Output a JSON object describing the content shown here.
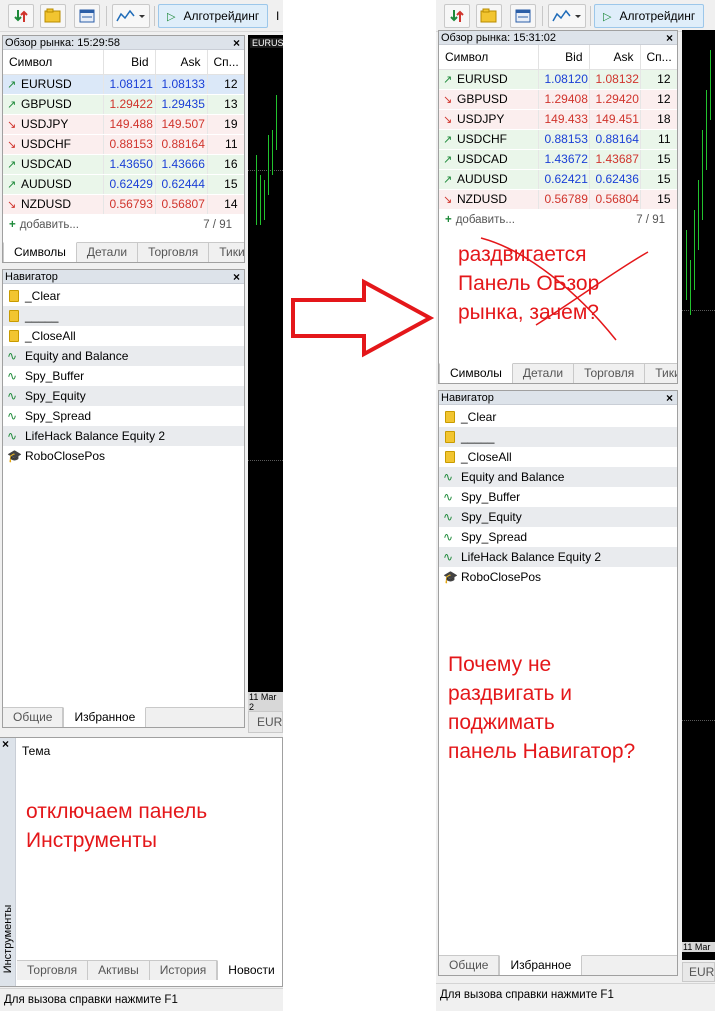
{
  "toolbar": {
    "algo_label": "Алготрейдинг",
    "extra_label_left": "I",
    "icons": [
      "trade-arrows-icon",
      "open-folder-icon",
      "template-icon",
      "chart-indicator-icon"
    ]
  },
  "left": {
    "market_watch": {
      "title": "Обзор рынка: 15:29:58",
      "columns": [
        "Символ",
        "Bid",
        "Ask",
        "Сп..."
      ],
      "rows": [
        {
          "symbol": "EURUSD",
          "bid": "1.08121",
          "ask": "1.08133",
          "spread": "12",
          "dir": "up",
          "bid_color": "blue",
          "ask_color": "blue",
          "selected": true
        },
        {
          "symbol": "GBPUSD",
          "bid": "1.29422",
          "ask": "1.29435",
          "spread": "13",
          "dir": "up",
          "bid_color": "red",
          "ask_color": "blue"
        },
        {
          "symbol": "USDJPY",
          "bid": "149.488",
          "ask": "149.507",
          "spread": "19",
          "dir": "dn",
          "bid_color": "red",
          "ask_color": "red"
        },
        {
          "symbol": "USDCHF",
          "bid": "0.88153",
          "ask": "0.88164",
          "spread": "11",
          "dir": "dn",
          "bid_color": "red",
          "ask_color": "red"
        },
        {
          "symbol": "USDCAD",
          "bid": "1.43650",
          "ask": "1.43666",
          "spread": "16",
          "dir": "up",
          "bid_color": "blue",
          "ask_color": "blue"
        },
        {
          "symbol": "AUDUSD",
          "bid": "0.62429",
          "ask": "0.62444",
          "spread": "15",
          "dir": "up",
          "bid_color": "blue",
          "ask_color": "blue"
        },
        {
          "symbol": "NZDUSD",
          "bid": "0.56793",
          "ask": "0.56807",
          "spread": "14",
          "dir": "dn",
          "bid_color": "red",
          "ask_color": "red"
        }
      ],
      "add_label": "добавить...",
      "count": "7 / 91",
      "tabs": [
        "Символы",
        "Детали",
        "Торговля",
        "Тики"
      ]
    },
    "navigator": {
      "title": "Навигатор",
      "items": [
        {
          "label": "_Clear",
          "icon": "folder-icon"
        },
        {
          "label": "_____",
          "icon": "folder-icon"
        },
        {
          "label": "_CloseAll",
          "icon": "folder-icon"
        },
        {
          "label": "Equity and Balance",
          "icon": "indicator-icon"
        },
        {
          "label": "Spy_Buffer",
          "icon": "indicator-icon"
        },
        {
          "label": "Spy_Equity",
          "icon": "indicator-icon"
        },
        {
          "label": "Spy_Spread",
          "icon": "indicator-icon"
        },
        {
          "label": "LifeHack Balance Equity 2",
          "icon": "indicator-icon"
        },
        {
          "label": "RoboClosePos",
          "icon": "graduation-cap-icon"
        }
      ],
      "tabs": [
        "Общие",
        "Избранное"
      ]
    },
    "chart": {
      "tab_label": "EURUS",
      "date_label": "11 Mar 2",
      "bottom_tab": "EURU"
    },
    "toolbox": {
      "vertical_title": "Инструменты",
      "column_header": "Тема",
      "tabs": [
        "Торговля",
        "Активы",
        "История",
        "Новости"
      ]
    },
    "status": "Для вызова справки нажмите F1",
    "annotation": "отключаем панель\nИнструменты"
  },
  "right": {
    "market_watch": {
      "title": "Обзор рынка: 15:31:02",
      "columns": [
        "Символ",
        "Bid",
        "Ask",
        "Сп..."
      ],
      "rows": [
        {
          "symbol": "EURUSD",
          "bid": "1.08120",
          "ask": "1.08132",
          "spread": "12",
          "dir": "up",
          "bid_color": "blue",
          "ask_color": "red"
        },
        {
          "symbol": "GBPUSD",
          "bid": "1.29408",
          "ask": "1.29420",
          "spread": "12",
          "dir": "dn",
          "bid_color": "red",
          "ask_color": "red"
        },
        {
          "symbol": "USDJPY",
          "bid": "149.433",
          "ask": "149.451",
          "spread": "18",
          "dir": "dn",
          "bid_color": "red",
          "ask_color": "red"
        },
        {
          "symbol": "USDCHF",
          "bid": "0.88153",
          "ask": "0.88164",
          "spread": "11",
          "dir": "up",
          "bid_color": "blue",
          "ask_color": "blue"
        },
        {
          "symbol": "USDCAD",
          "bid": "1.43672",
          "ask": "1.43687",
          "spread": "15",
          "dir": "up",
          "bid_color": "blue",
          "ask_color": "red"
        },
        {
          "symbol": "AUDUSD",
          "bid": "0.62421",
          "ask": "0.62436",
          "spread": "15",
          "dir": "up",
          "bid_color": "blue",
          "ask_color": "blue"
        },
        {
          "symbol": "NZDUSD",
          "bid": "0.56789",
          "ask": "0.56804",
          "spread": "15",
          "dir": "dn",
          "bid_color": "red",
          "ask_color": "red"
        }
      ],
      "add_label": "добавить...",
      "count": "7 / 91",
      "tabs": [
        "Символы",
        "Детали",
        "Торговля",
        "Тики"
      ],
      "annotation": "раздвигается\nПанель ОБзор\nрынка, зачем?"
    },
    "navigator": {
      "title": "Навигатор",
      "items": [
        {
          "label": "_Clear",
          "icon": "folder-icon"
        },
        {
          "label": "_____",
          "icon": "folder-icon"
        },
        {
          "label": "_CloseAll",
          "icon": "folder-icon"
        },
        {
          "label": "Equity and Balance",
          "icon": "indicator-icon"
        },
        {
          "label": "Spy_Buffer",
          "icon": "indicator-icon"
        },
        {
          "label": "Spy_Equity",
          "icon": "indicator-icon"
        },
        {
          "label": "Spy_Spread",
          "icon": "indicator-icon"
        },
        {
          "label": "LifeHack Balance Equity 2",
          "icon": "indicator-icon"
        },
        {
          "label": "RoboClosePos",
          "icon": "graduation-cap-icon"
        }
      ],
      "tabs": [
        "Общие",
        "Избранное"
      ],
      "annotation": "Почему не\nраздвигать и\nподжимать\nпанель Навигатор?"
    },
    "chart": {
      "date_label": "11 Mar",
      "bottom_tab": "EUR"
    },
    "status": "Для вызова справки нажмите F1"
  },
  "colors": {
    "annotation": "#e4171a",
    "bid_up": "#1a3fd6",
    "bid_down": "#d0342c",
    "chart_bg": "#000000",
    "candle": "#22c32e"
  }
}
